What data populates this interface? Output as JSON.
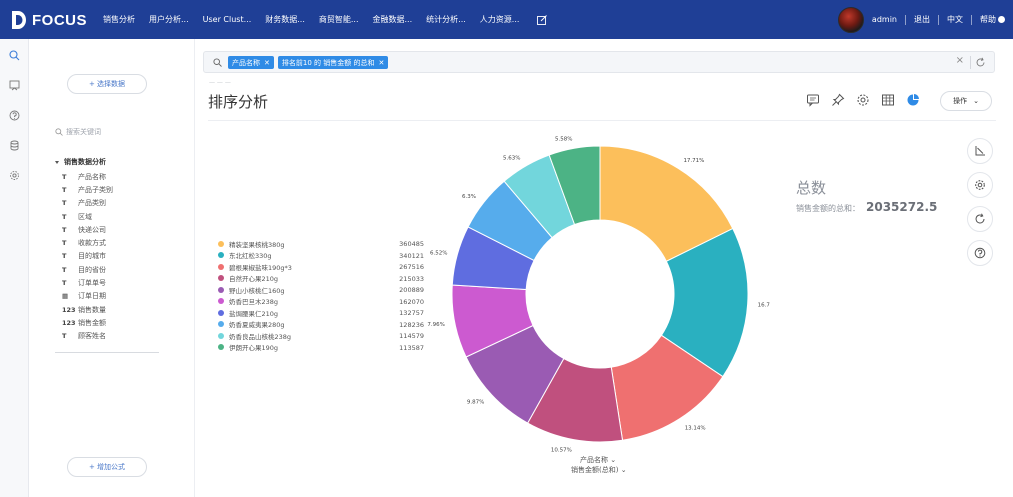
{
  "header": {
    "logo_text": "FOCUS",
    "nav": [
      "销售分析",
      "用户分析...",
      "User Clust...",
      "财务数据...",
      "商贸智能...",
      "金融数据...",
      "统计分析...",
      "人力资源..."
    ],
    "username": "admin",
    "logout": "退出",
    "language": "中文",
    "help": "帮助"
  },
  "left": {
    "select_data": "+ 选择数据",
    "search_placeholder": "搜索关键词",
    "tree_title": "销售数据分析",
    "fields": [
      {
        "icon": "T",
        "label": "产品名称"
      },
      {
        "icon": "T",
        "label": "产品子类别"
      },
      {
        "icon": "T",
        "label": "产品类别"
      },
      {
        "icon": "T",
        "label": "区域"
      },
      {
        "icon": "T",
        "label": "快递公司"
      },
      {
        "icon": "T",
        "label": "收款方式"
      },
      {
        "icon": "T",
        "label": "目的城市"
      },
      {
        "icon": "T",
        "label": "目的省份"
      },
      {
        "icon": "T",
        "label": "订单单号"
      },
      {
        "icon": "▦",
        "label": "订单日期"
      },
      {
        "icon": "123",
        "label": "销售数量"
      },
      {
        "icon": "123",
        "label": "销售金额"
      },
      {
        "icon": "T",
        "label": "顾客姓名"
      }
    ],
    "add_formula": "+ 增加公式"
  },
  "search": {
    "tags": [
      "产品名称",
      "排名前10 的 销售金额 的总和"
    ]
  },
  "page": {
    "title": "排序分析",
    "operation": "操作"
  },
  "total": {
    "title": "总数",
    "label": "销售金额的总和：",
    "value": "2035272.5"
  },
  "chart_data": {
    "type": "pie",
    "donut": true,
    "categories": [
      "精装坚果核桃380g",
      "东北红松330g",
      "碧根果椒盐味190g*3",
      "自然开心果210g",
      "野山小核桃仁160g",
      "奶香巴旦木238g",
      "盐焗腰果仁210g",
      "奶香夏威夷果280g",
      "奶香良品山核桃238g",
      "伊朗开心果190g"
    ],
    "values": [
      360485,
      340121,
      267516,
      215033,
      200889,
      162070,
      132757,
      128236,
      114579,
      113587
    ],
    "value_labels": [
      "17.71%",
      "16.7",
      "13.14%",
      "10.57%",
      "9.87%",
      "7.96%",
      "6.52%",
      "6.3%",
      "5.63%",
      "5.58%"
    ],
    "colors": [
      "#fcbf5b",
      "#2ab0c0",
      "#ef7070",
      "#c0507e",
      "#9a5bb3",
      "#cc5ad0",
      "#5f6de0",
      "#56acec",
      "#72d6dc",
      "#4cb385"
    ],
    "axis_labels": [
      "产品名称",
      "销售金额(总和)"
    ]
  }
}
